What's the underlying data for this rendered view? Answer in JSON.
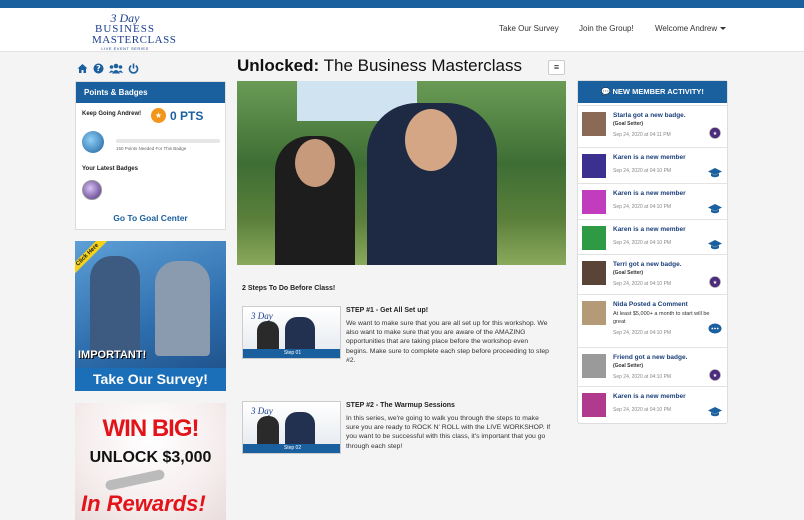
{
  "header": {
    "logo": {
      "line1": "3 Day",
      "line2": "BUSINESS",
      "line3": "MASTERCLASS",
      "line4": "LIVE EVENT SERIES"
    },
    "nav": [
      {
        "label": "Take Our Survey"
      },
      {
        "label": "Join the Group!"
      },
      {
        "label": "Welcome Andrew"
      }
    ]
  },
  "icons": [
    "home-icon",
    "help-icon",
    "users-icon",
    "power-icon"
  ],
  "points_panel": {
    "title": "Points & Badges",
    "keep_going": "Keep Going Andrew!",
    "points": "0 PTS",
    "points_needed": "150 Points Needed For This Badge",
    "progress_fraction": 0,
    "latest_badges": "Your Latest Badges",
    "goal_link": "Go To Goal Center"
  },
  "ads": {
    "survey": {
      "corner": "Click Here",
      "important": "IMPORTANT!",
      "cta": "Take Our Survey!"
    },
    "win": {
      "headline": "WIN BIG!",
      "sub": "UNLOCK $3,000",
      "bottom": "In Rewards!"
    }
  },
  "main": {
    "title_bold": "Unlocked:",
    "title_rest": "The Business Masterclass",
    "steps_title": "2 Steps To Do Before Class!",
    "steps": [
      {
        "thumb_logo": "3 Day",
        "thumb_label": "Step 01",
        "heading": "STEP #1 - Get All Set up!",
        "body": "We want to make sure that you are all set up for this workshop. We also want to make sure that you are aware of the AMAZING opportunities that are taking place before the workshop even begins. Make sure to complete each step before proceeding to step #2."
      },
      {
        "thumb_logo": "3 Day",
        "thumb_label": "Step 02",
        "heading": "STEP #2 - The Warmup Sessions",
        "body": "In this series, we're going to walk you through the steps to make sure you are ready to ROCK N' ROLL with the LIVE WORKSHOP. If you want to be successful with this class, it's important that you go through each step!"
      }
    ]
  },
  "activity": {
    "title": "NEW MEMBER ACTIVITY!",
    "items": [
      {
        "title": "Starla got a new badge.",
        "sub": "(Goal Setter)",
        "date": "Sep 24, 2020 at 04:11 PM",
        "icon": "badge-icon",
        "avatar": "#8a6a55"
      },
      {
        "title": "Karen is a new member",
        "date": "Sep 24, 2020 at 04:10 PM",
        "icon": "graduation-cap-icon",
        "avatar": "#3b2f8f"
      },
      {
        "title": "Karen is a new member",
        "date": "Sep 24, 2020 at 04:10 PM",
        "icon": "graduation-cap-icon",
        "avatar": "#c23dbd"
      },
      {
        "title": "Karen is a new member",
        "date": "Sep 24, 2020 at 04:10 PM",
        "icon": "graduation-cap-icon",
        "avatar": "#2e9a43"
      },
      {
        "title": "Terri got a new badge.",
        "sub": "(Goal Setter)",
        "date": "Sep 24, 2020 at 04:10 PM",
        "icon": "badge-icon",
        "avatar": "#5a4438"
      },
      {
        "title": "Nida Posted a Comment",
        "msg": "At least $5,000+ a month to start will be great",
        "date": "Sep 24, 2020 at 04:10 PM",
        "icon": "comment-icon",
        "avatar": "#b59a78"
      },
      {
        "title": "Friend got a new badge.",
        "sub": "(Goal Setter)",
        "date": "Sep 24, 2020 at 04:10 PM",
        "icon": "badge-icon",
        "avatar": "#9a9a9a"
      },
      {
        "title": "Karen is a new member",
        "date": "Sep 24, 2020 at 04:10 PM",
        "icon": "graduation-cap-icon",
        "avatar": "#b03a8e"
      }
    ]
  },
  "colors": {
    "brand": "#1a5f9e",
    "accent": "#f2961a",
    "red": "#e2141a"
  }
}
